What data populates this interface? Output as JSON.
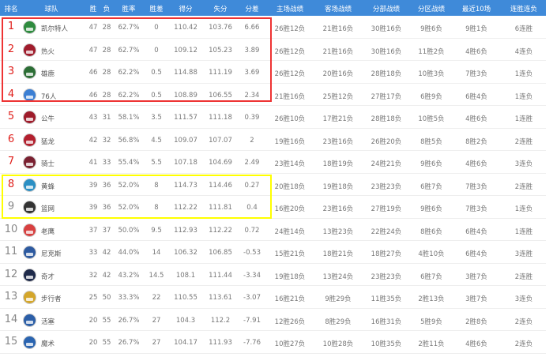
{
  "header": [
    "排名",
    "球队",
    "胜",
    "负",
    "胜率",
    "胜差",
    "得分",
    "失分",
    "分差",
    "主场战绩",
    "客场战绩",
    "分部战绩",
    "分区战绩",
    "最近10场",
    "连胜连负"
  ],
  "rows": [
    {
      "rank": "1",
      "team": "凯尔特人",
      "w": "47",
      "l": "28",
      "pct": "62.7%",
      "gb": "0",
      "pf": "110.42",
      "pa": "103.76",
      "diff": "6.66",
      "home": "26胜12负",
      "away": "21胜16负",
      "div": "30胜16负",
      "conf": "9胜6负",
      "last10": "9胜1负",
      "streak": "6连胜",
      "color": "#2e8b3e"
    },
    {
      "rank": "2",
      "team": "热火",
      "w": "47",
      "l": "28",
      "pct": "62.7%",
      "gb": "0",
      "pf": "109.12",
      "pa": "105.23",
      "diff": "3.89",
      "home": "26胜12负",
      "away": "21胜16负",
      "div": "30胜16负",
      "conf": "11胜2负",
      "last10": "4胜6负",
      "streak": "4连负",
      "color": "#a01c2c"
    },
    {
      "rank": "3",
      "team": "雄鹿",
      "w": "46",
      "l": "28",
      "pct": "62.2%",
      "gb": "0.5",
      "pf": "114.88",
      "pa": "111.19",
      "diff": "3.69",
      "home": "26胜12负",
      "away": "20胜16负",
      "div": "28胜18负",
      "conf": "10胜3负",
      "last10": "7胜3负",
      "streak": "1连负",
      "color": "#2c6e35"
    },
    {
      "rank": "4",
      "team": "76人",
      "w": "46",
      "l": "28",
      "pct": "62.2%",
      "gb": "0.5",
      "pf": "108.89",
      "pa": "106.55",
      "diff": "2.34",
      "home": "21胜16负",
      "away": "25胜12负",
      "div": "27胜17负",
      "conf": "6胜9负",
      "last10": "6胜4负",
      "streak": "1连负",
      "color": "#3b7fd4"
    },
    {
      "rank": "5",
      "team": "公牛",
      "w": "43",
      "l": "31",
      "pct": "58.1%",
      "gb": "3.5",
      "pf": "111.57",
      "pa": "111.18",
      "diff": "0.39",
      "home": "26胜10负",
      "away": "17胜21负",
      "div": "28胜18负",
      "conf": "10胜5负",
      "last10": "4胜6负",
      "streak": "1连胜",
      "color": "#9e1b2a"
    },
    {
      "rank": "6",
      "team": "猛龙",
      "w": "42",
      "l": "32",
      "pct": "56.8%",
      "gb": "4.5",
      "pf": "109.07",
      "pa": "107.07",
      "diff": "2",
      "home": "19胜16负",
      "away": "23胜16负",
      "div": "26胜20负",
      "conf": "8胜5负",
      "last10": "8胜2负",
      "streak": "2连胜",
      "color": "#b3202e"
    },
    {
      "rank": "7",
      "team": "骑士",
      "w": "41",
      "l": "33",
      "pct": "55.4%",
      "gb": "5.5",
      "pf": "107.18",
      "pa": "104.69",
      "diff": "2.49",
      "home": "23胜14负",
      "away": "18胜19负",
      "div": "24胜21负",
      "conf": "9胜6负",
      "last10": "4胜6负",
      "streak": "3连负",
      "color": "#7a2131"
    },
    {
      "rank": "8",
      "team": "黄蜂",
      "w": "39",
      "l": "36",
      "pct": "52.0%",
      "gb": "8",
      "pf": "114.73",
      "pa": "114.46",
      "diff": "0.27",
      "home": "20胜18负",
      "away": "19胜18负",
      "div": "23胜23负",
      "conf": "6胜7负",
      "last10": "7胜3负",
      "streak": "2连胜",
      "color": "#2a8fc4"
    },
    {
      "rank": "9",
      "team": "篮网",
      "w": "39",
      "l": "36",
      "pct": "52.0%",
      "gb": "8",
      "pf": "112.22",
      "pa": "111.81",
      "diff": "0.4",
      "home": "16胜20负",
      "away": "23胜16负",
      "div": "27胜19负",
      "conf": "9胜6负",
      "last10": "7胜3负",
      "streak": "1连负",
      "color": "#333333"
    },
    {
      "rank": "10",
      "team": "老鹰",
      "w": "37",
      "l": "37",
      "pct": "50.0%",
      "gb": "9.5",
      "pf": "112.93",
      "pa": "112.22",
      "diff": "0.72",
      "home": "24胜14负",
      "away": "13胜23负",
      "div": "22胜24负",
      "conf": "8胜6负",
      "last10": "6胜4负",
      "streak": "1连胜",
      "color": "#d84040"
    },
    {
      "rank": "11",
      "team": "尼克斯",
      "w": "33",
      "l": "42",
      "pct": "44.0%",
      "gb": "14",
      "pf": "106.32",
      "pa": "106.85",
      "diff": "-0.53",
      "home": "15胜21负",
      "away": "18胜21负",
      "div": "18胜27负",
      "conf": "4胜10负",
      "last10": "6胜4负",
      "streak": "3连胜",
      "color": "#2d5aa0"
    },
    {
      "rank": "12",
      "team": "奇才",
      "w": "32",
      "l": "42",
      "pct": "43.2%",
      "gb": "14.5",
      "pf": "108.1",
      "pa": "111.44",
      "diff": "-3.34",
      "home": "19胜18负",
      "away": "13胜24负",
      "div": "23胜23负",
      "conf": "6胜7负",
      "last10": "3胜7负",
      "streak": "2连胜",
      "color": "#1e2a4a"
    },
    {
      "rank": "13",
      "team": "步行者",
      "w": "25",
      "l": "50",
      "pct": "33.3%",
      "gb": "22",
      "pf": "110.55",
      "pa": "113.61",
      "diff": "-3.07",
      "home": "16胜21负",
      "away": "9胜29负",
      "div": "11胜35负",
      "conf": "2胜13负",
      "last10": "3胜7负",
      "streak": "3连负",
      "color": "#d4a62a"
    },
    {
      "rank": "14",
      "team": "活塞",
      "w": "20",
      "l": "55",
      "pct": "26.7%",
      "gb": "27",
      "pf": "104.3",
      "pa": "112.2",
      "diff": "-7.91",
      "home": "12胜26负",
      "away": "8胜29负",
      "div": "16胜31负",
      "conf": "5胜9负",
      "last10": "2胜8负",
      "streak": "2连负",
      "color": "#2c5fa8"
    },
    {
      "rank": "15",
      "team": "魔术",
      "w": "20",
      "l": "55",
      "pct": "26.7%",
      "gb": "27",
      "pf": "104.17",
      "pa": "111.93",
      "diff": "-7.76",
      "home": "10胜27负",
      "away": "10胜28负",
      "div": "10胜35负",
      "conf": "2胜11负",
      "last10": "4胜6负",
      "streak": "2连负",
      "color": "#2a64b0"
    }
  ],
  "colors": {
    "header": "#3f8ad9",
    "top4_box": "#ee3333",
    "playin_box": "#ffff00",
    "rank_red": "#e0201c"
  }
}
